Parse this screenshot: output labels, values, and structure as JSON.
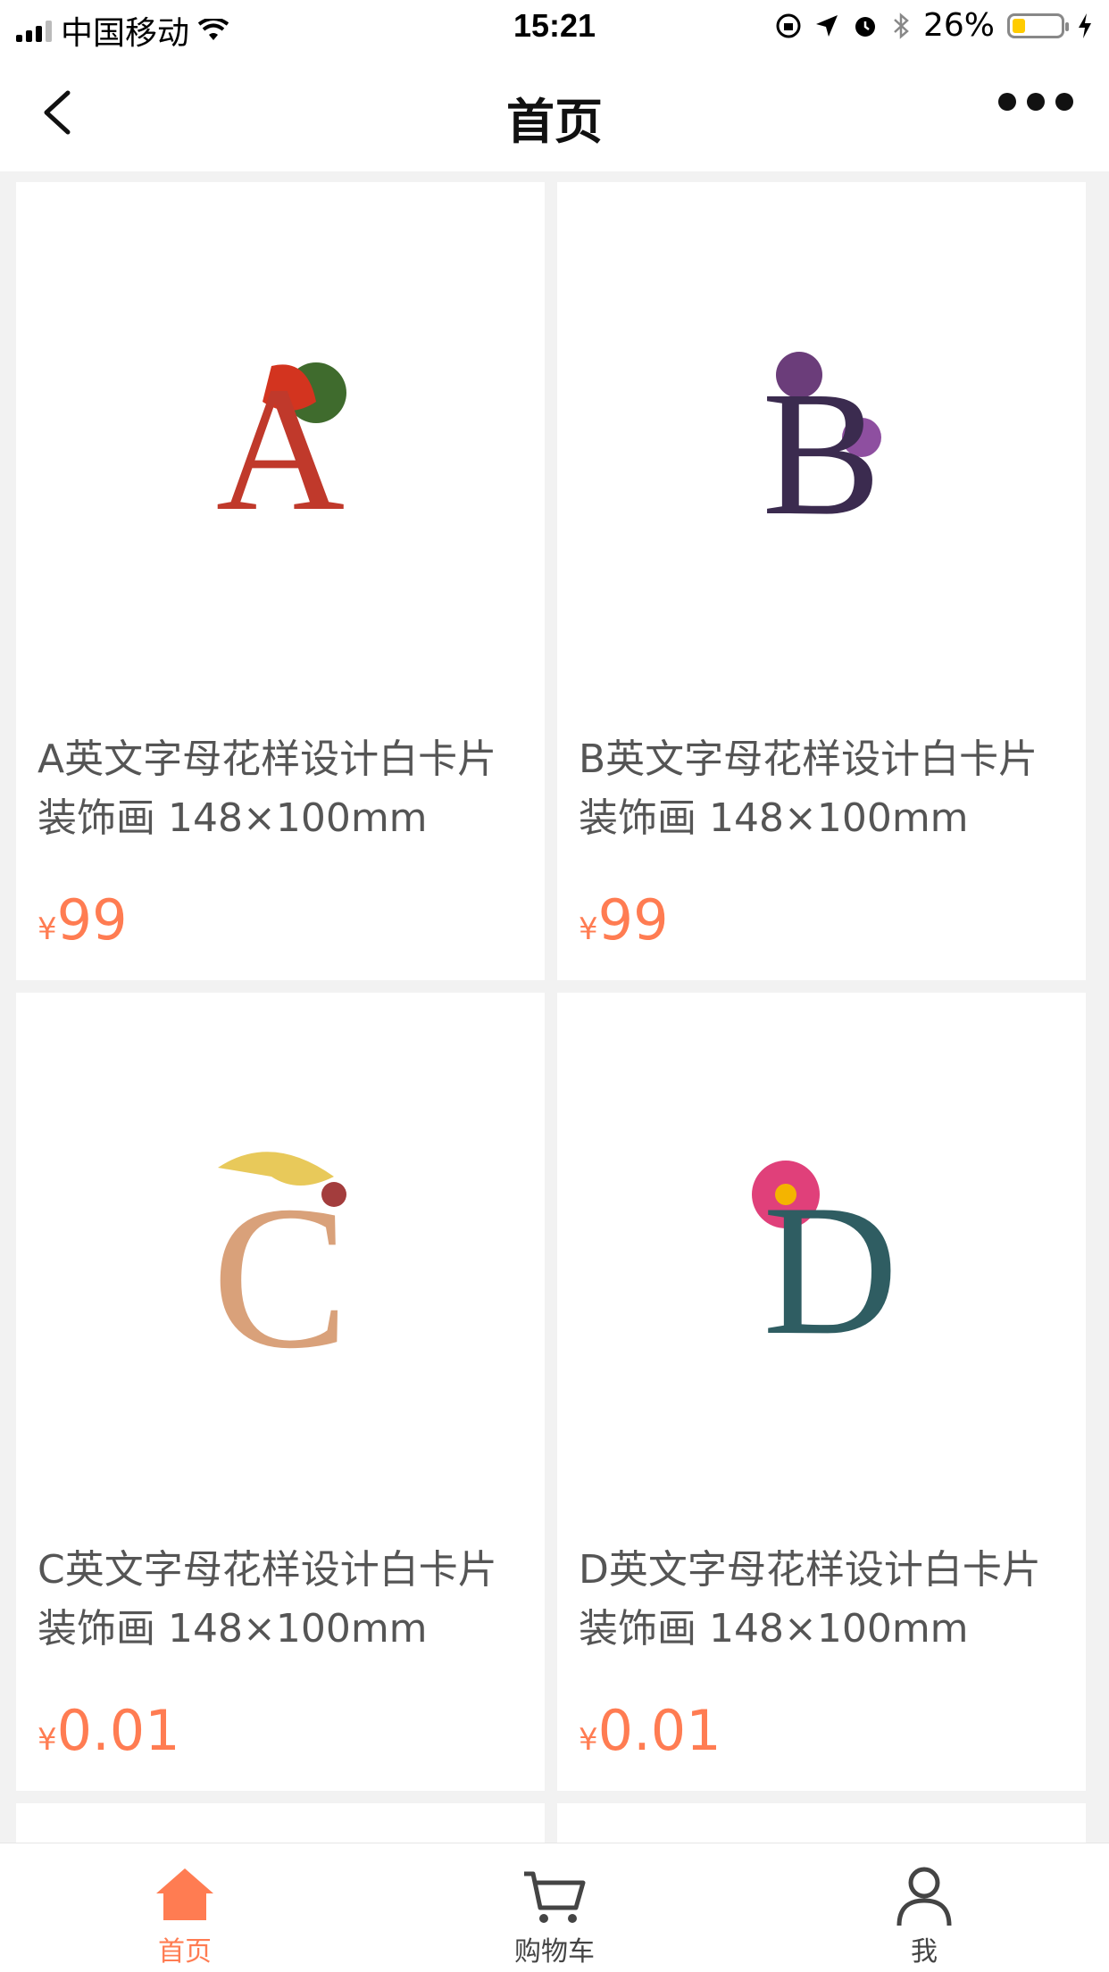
{
  "status_bar": {
    "carrier": "中国移动",
    "time": "15:21",
    "battery": "26%",
    "battery_level": 0.26
  },
  "nav": {
    "title": "首页"
  },
  "products": [
    {
      "letter": "A",
      "title": "A英文字母花样设计白卡片 装饰画 148×100mm",
      "currency": "¥",
      "price": "99",
      "colors": [
        "#c0392b",
        "#e04b2a",
        "#3f6b2d"
      ]
    },
    {
      "letter": "B",
      "title": "B英文字母花样设计白卡片 装饰画 148×100mm",
      "currency": "¥",
      "price": "99",
      "colors": [
        "#3b2b4f",
        "#6b3d7a",
        "#3d5b3a"
      ]
    },
    {
      "letter": "C",
      "title": "C英文字母花样设计白卡片 装饰画 148×100mm",
      "currency": "¥",
      "price": "0.01",
      "colors": [
        "#d9a17a",
        "#e8c95a",
        "#a33d3d"
      ]
    },
    {
      "letter": "D",
      "title": "D英文字母花样设计白卡片 装饰画 148×100mm",
      "currency": "¥",
      "price": "0.01",
      "colors": [
        "#2f5d62",
        "#e0407a",
        "#4d7a5a"
      ]
    }
  ],
  "tabs": [
    {
      "label": "首页",
      "icon": "home-icon",
      "active": true
    },
    {
      "label": "购物车",
      "icon": "cart-icon",
      "active": false
    },
    {
      "label": "我",
      "icon": "user-icon",
      "active": false
    }
  ],
  "colors": {
    "accent": "#ff7c52",
    "background": "#f2f2f2"
  }
}
